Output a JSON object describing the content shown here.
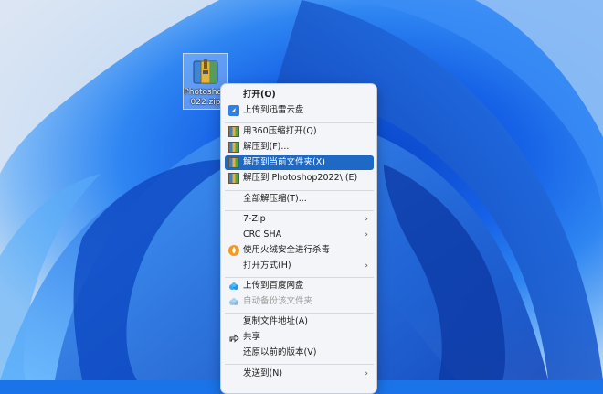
{
  "desktop": {
    "file": {
      "name_line1": "Photoshop",
      "name_line2": "022.zip"
    }
  },
  "menu": {
    "items": [
      {
        "label": "打开(O)",
        "icon": "none"
      },
      {
        "label": "上传到迅雷云盘",
        "icon": "xunlei-bird-icon"
      },
      {
        "label": "用360压缩打开(Q)",
        "icon": "zip-archive-icon"
      },
      {
        "label": "解压到(F)...",
        "icon": "zip-archive-icon"
      },
      {
        "label": "解压到当前文件夹(X)",
        "icon": "zip-archive-icon"
      },
      {
        "label": "解压到 Photoshop2022\\ (E)",
        "icon": "zip-archive-icon"
      },
      {
        "label": "全部解压缩(T)...",
        "icon": "none"
      },
      {
        "label": "7-Zip",
        "icon": "none"
      },
      {
        "label": "CRC SHA",
        "icon": "none"
      },
      {
        "label": "使用火绒安全进行杀毒",
        "icon": "huorong-shield-icon"
      },
      {
        "label": "打开方式(H)",
        "icon": "none"
      },
      {
        "label": "上传到百度网盘",
        "icon": "baidu-cloud-icon"
      },
      {
        "label": "自动备份该文件夹",
        "icon": "baidu-cloud-icon"
      },
      {
        "label": "复制文件地址(A)",
        "icon": "none"
      },
      {
        "label": "共享",
        "icon": "share-icon"
      },
      {
        "label": "还原以前的版本(V)",
        "icon": "none"
      },
      {
        "label": "发送到(N)",
        "icon": "none"
      }
    ],
    "arrow": "›"
  },
  "colors": {
    "selected": "#1e69c6",
    "wallpaper_blue": "#1661e6"
  }
}
